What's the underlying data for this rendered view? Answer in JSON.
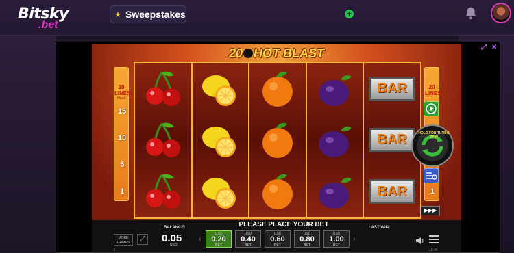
{
  "header": {
    "brand_top": "Bitsky",
    "brand_sub": ".bet",
    "sweeps_label": "Sweepstakes",
    "add_symbol": "+"
  },
  "frame_controls": {
    "expand_symbol": "⤢",
    "close_symbol": "✕"
  },
  "game": {
    "title_pre": "20",
    "title_post": "HOT BLAST",
    "lines_label": "20 LINES",
    "lines_fixed": "Fixed",
    "left_numbers": [
      "15",
      "10",
      "5",
      "1"
    ],
    "right_numbers": [
      "1"
    ],
    "turbo_label": "HOLD FOR TURBO SPIN",
    "autoplay_symbol": "▶▶▶",
    "reels": [
      [
        "cherry",
        "cherry",
        "cherry"
      ],
      [
        "lemon",
        "lemon",
        "lemon"
      ],
      [
        "orange",
        "orange",
        "orange"
      ],
      [
        "plum",
        "plum",
        "plum"
      ],
      [
        "bar",
        "bar",
        "bar"
      ]
    ],
    "bar_text": "BAR"
  },
  "bottom": {
    "message": "PLEASE PLACE YOUR BET",
    "balance_label": "BALANCE:",
    "balance_value": "0.05",
    "balance_currency": "USD",
    "last_win_label": "LAST WIN:",
    "more_games": "MORE GAMES",
    "bets": [
      {
        "currency": "USD",
        "value": "0.20",
        "label": "BET",
        "selected": true
      },
      {
        "currency": "USD",
        "value": "0.40",
        "label": "BET",
        "selected": false
      },
      {
        "currency": "USD",
        "value": "0.60",
        "label": "BET",
        "selected": false
      },
      {
        "currency": "USD",
        "value": "0.80",
        "label": "BET",
        "selected": false
      },
      {
        "currency": "USD",
        "value": "1.00",
        "label": "BET",
        "selected": false
      }
    ],
    "footer_left": "-1",
    "footer_time": "15:46"
  },
  "colors": {
    "accent": "#e13ac7",
    "reel_border": "#f7b335",
    "selected_bet": "#3a7d1d"
  }
}
